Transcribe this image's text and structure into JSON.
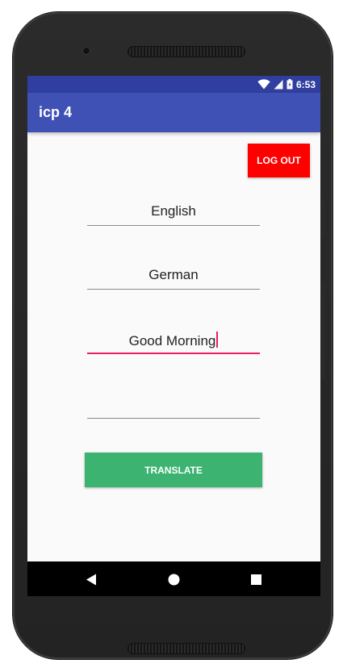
{
  "status_bar": {
    "time": "6:53",
    "icons": [
      "wifi-icon",
      "cell-signal-icon",
      "battery-icon"
    ]
  },
  "app_bar": {
    "title": "icp 4"
  },
  "logout": {
    "label": "LOG OUT"
  },
  "fields": {
    "source_language": {
      "value": "English"
    },
    "target_language": {
      "value": "German"
    },
    "input_text": {
      "value": "Good Morning"
    },
    "output_text": {
      "value": ""
    }
  },
  "translate": {
    "label": "TRANSLATE"
  },
  "nav": {
    "icons": [
      "back-icon",
      "home-icon",
      "recents-icon"
    ]
  },
  "colors": {
    "status_bar": "#303f9f",
    "app_bar": "#3f51b5",
    "logout_button": "#ff0000",
    "translate_button": "#3cb371",
    "focus_accent": "#e91e63"
  }
}
